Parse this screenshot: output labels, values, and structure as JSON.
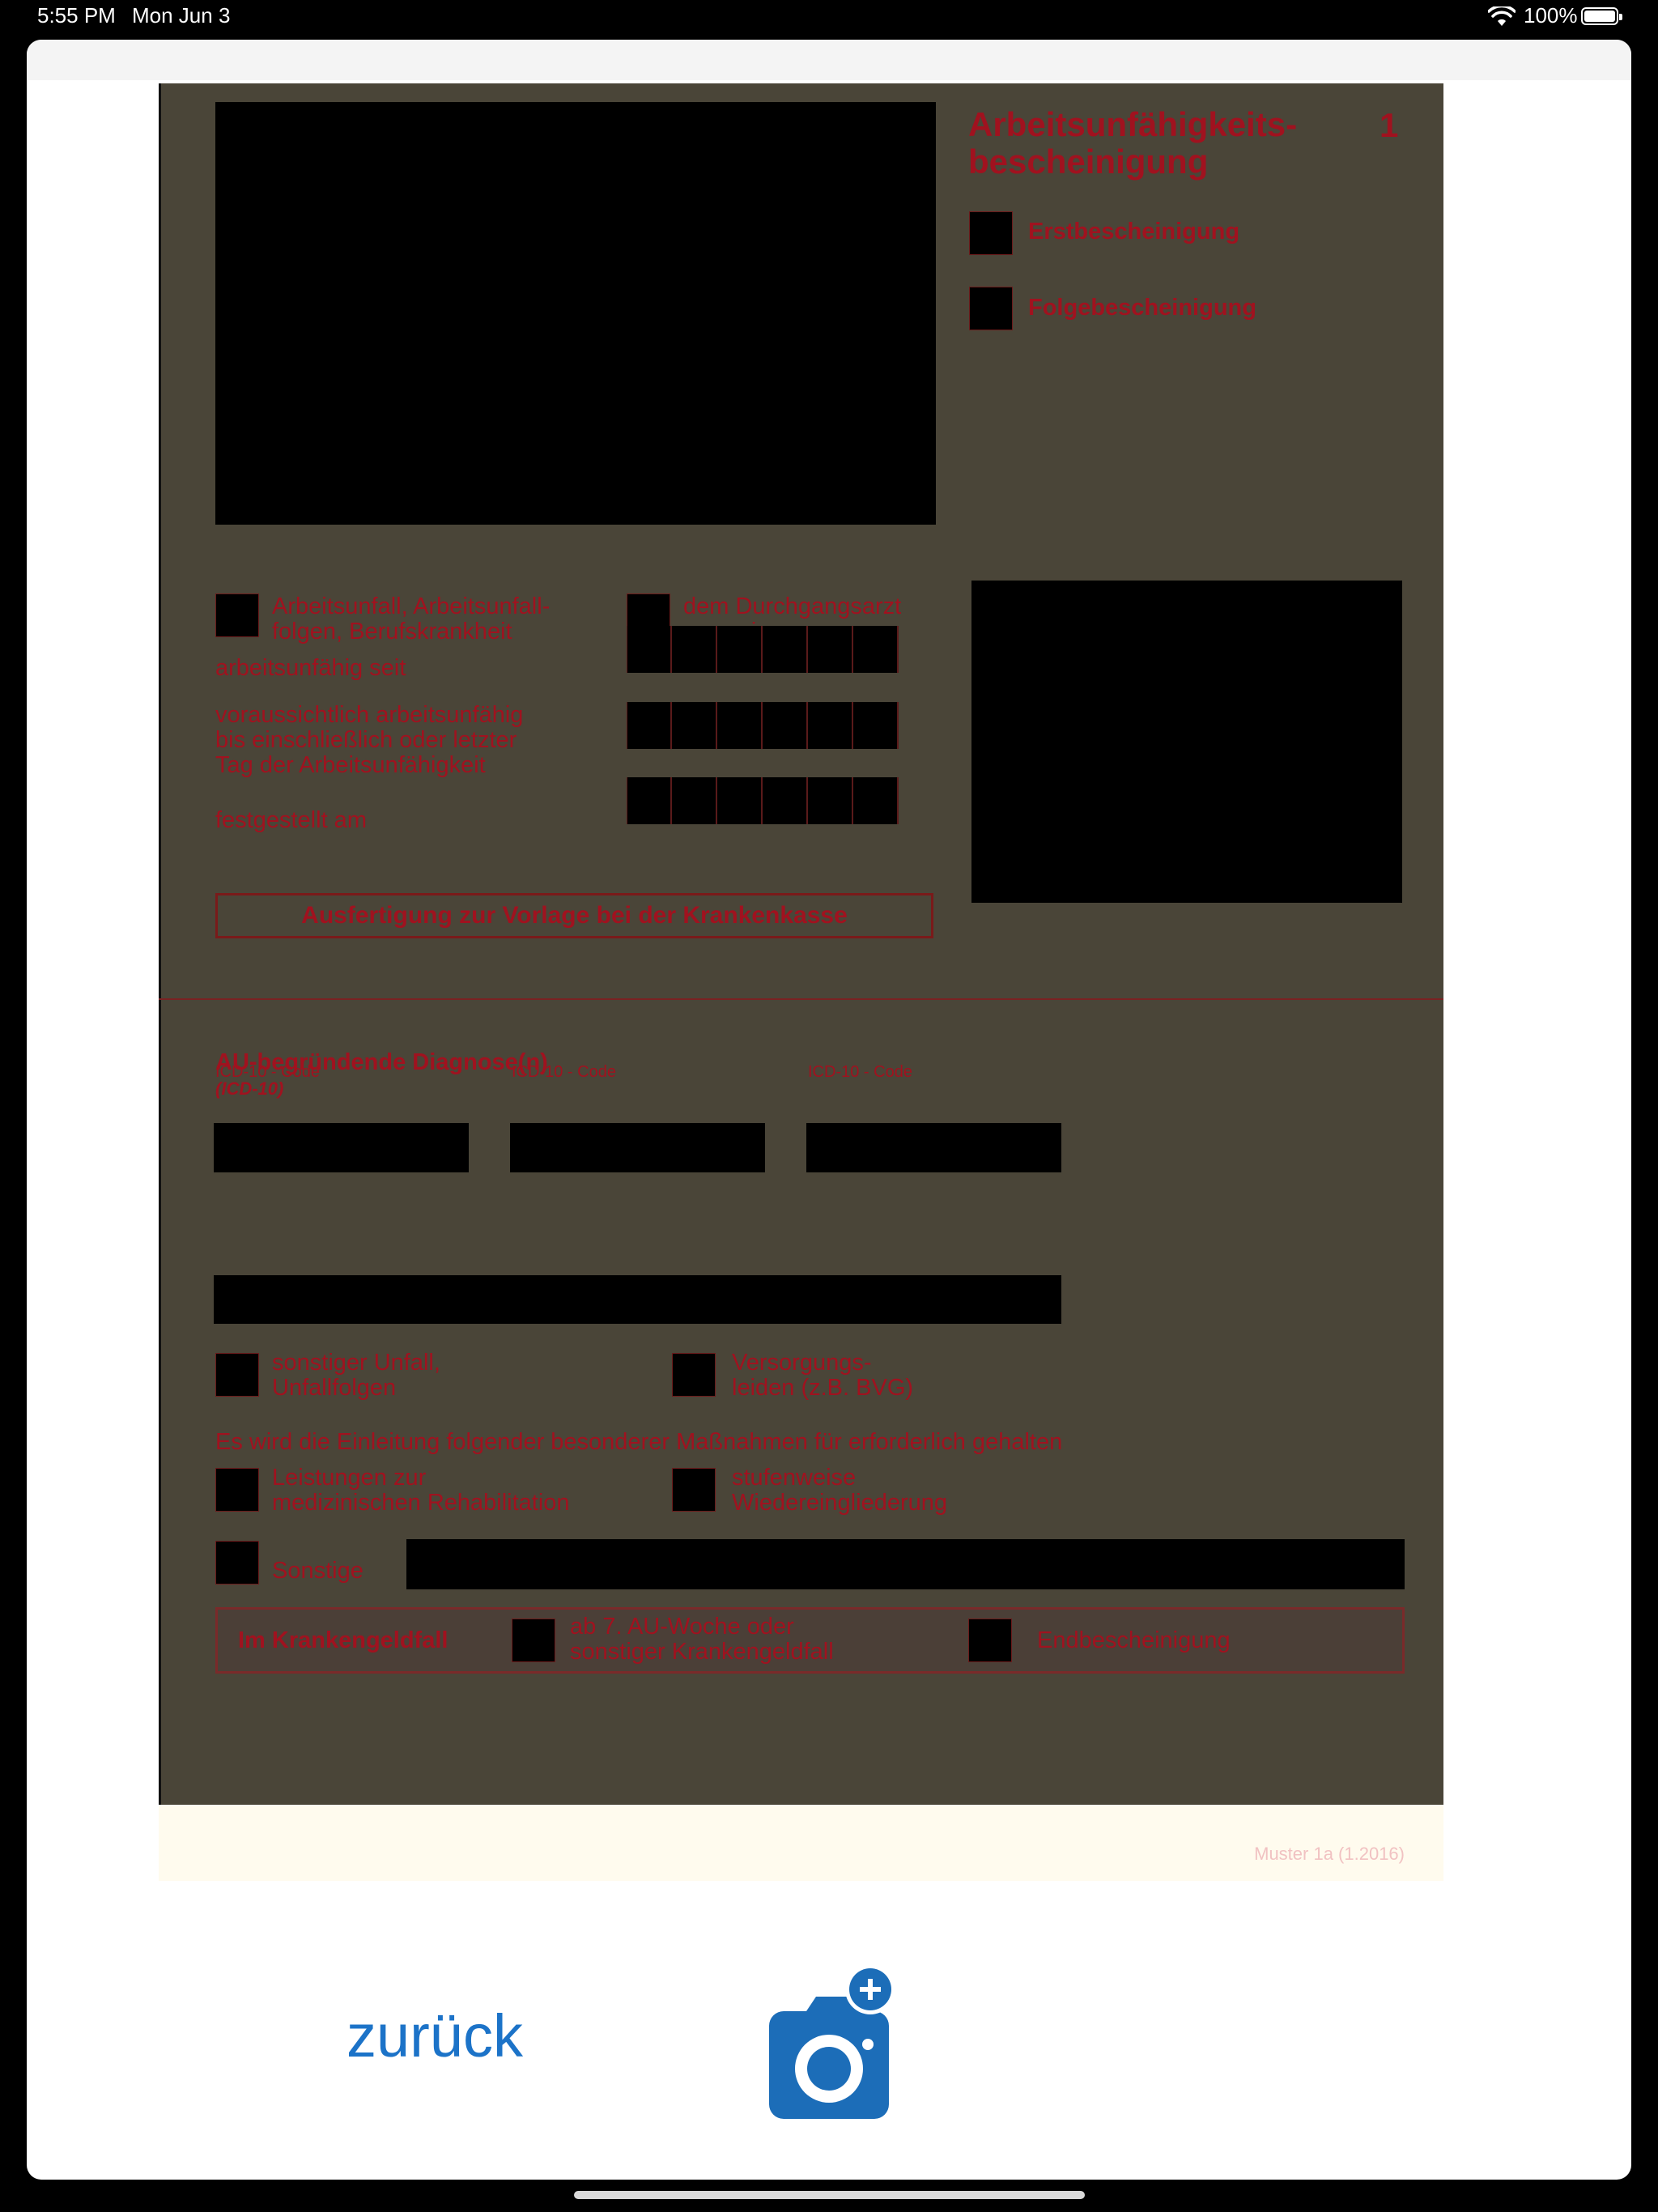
{
  "status_bar": {
    "time": "5:55 PM",
    "date": "Mon Jun 3",
    "battery_percent": "100%"
  },
  "document": {
    "title": "Arbeitsunfähigkeits-\nbescheinigung",
    "number": "1",
    "checkboxes_top": [
      {
        "label": "Erstbescheinigung"
      },
      {
        "label": "Folgebescheinigung"
      }
    ],
    "accident_label": "Arbeitsunfall, Arbeitsunfall-\nfolgen, Berufskrankheit",
    "doctor_label": "dem Durchgangsarzt\nzugewiesen",
    "fields": {
      "since_label": "arbeitsunfähig seit",
      "until_label": "voraussichtlich arbeitsunfähig\nbis einschließlich oder letzter\nTag der Arbeitsunfähigkeit",
      "determined_label": "festgestellt am"
    },
    "notice": "Ausfertigung zur Vorlage bei der Krankenkasse",
    "diagnosis_heading": "AU-begründende Diagnose(n)",
    "diagnosis_suffix": "(ICD-10)",
    "icd_label": "ICD-10 - Code",
    "other_accident_label": "sonstiger Unfall,\nUnfallfolgen",
    "supply_label": "Versorgungs-\nleiden (z.B. BVG)",
    "measures_heading": "Es wird die Einleitung folgender besonderer Maßnahmen für erforderlich gehalten",
    "rehab_label": "Leistungen zur\nmedizinischen Rehabilitation",
    "reintegration_label": "stufenweise\nWiedereingliederung",
    "other_label": "Sonstige",
    "sick_pay_label": "Im Krankengeldfall",
    "sick_pay_week_label": "ab 7. AU-Woche oder\nsonstiger Krankengeldfall",
    "final_label": "Endbescheinigung",
    "muster": "Muster 1a (1.2016)"
  },
  "actions": {
    "back_label": "zurück",
    "camera_icon": "camera-add-icon"
  },
  "colors": {
    "accent": "#1c73c8",
    "form_red": "#a0121f"
  }
}
